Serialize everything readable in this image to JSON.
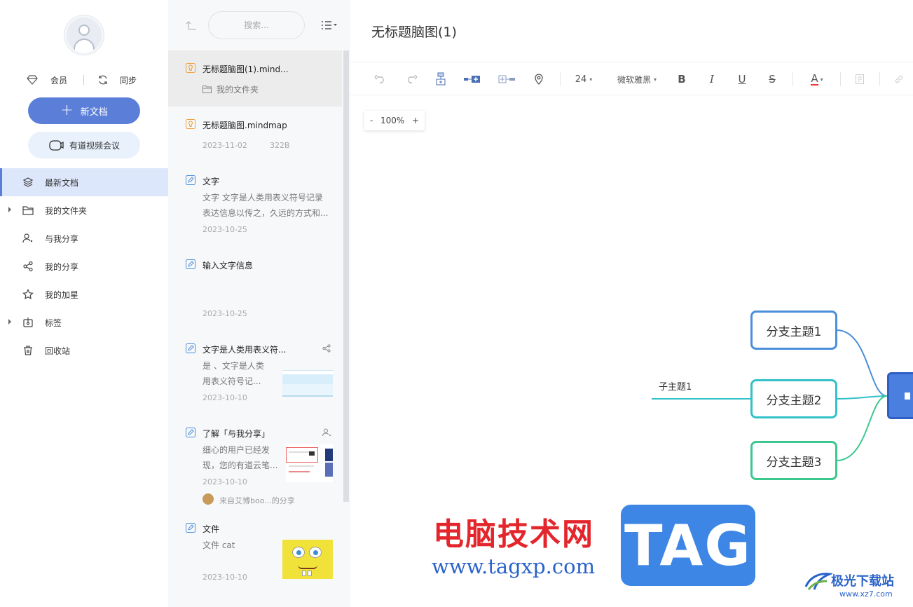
{
  "sidebar": {
    "vip_label": "会员",
    "sync_label": "同步",
    "new_doc_label": "新文档",
    "meeting_label": "有道视频会议",
    "nav": [
      {
        "label": "最新文档",
        "icon": "layers-icon",
        "active": true
      },
      {
        "label": "我的文件夹",
        "icon": "folder-icon",
        "expandable": true
      },
      {
        "label": "与我分享",
        "icon": "users-icon"
      },
      {
        "label": "我的分享",
        "icon": "share-icon"
      },
      {
        "label": "我的加星",
        "icon": "star-icon"
      },
      {
        "label": "标签",
        "icon": "tag-icon",
        "expandable": true
      },
      {
        "label": "回收站",
        "icon": "trash-icon"
      }
    ]
  },
  "doclist": {
    "search_placeholder": "搜索...",
    "docs": [
      {
        "title": "无标题脑图(1).mind...",
        "folder": "我的文件夹"
      },
      {
        "title": "无标题脑图.mindmap",
        "date": "2023-11-02",
        "size": "322B"
      },
      {
        "title": "文字",
        "line1": "文字 文字是人类用表义符号记录",
        "line2": "表达信息以传之，久远的方式和...",
        "date": "2023-10-25"
      },
      {
        "title": "输入文字信息",
        "date": "2023-10-25"
      },
      {
        "title": "文字是人类用表义符...",
        "line1": "是 、文字是人类",
        "line2": "用表义符号记...",
        "date": "2023-10-10"
      },
      {
        "title": "了解「与我分享」",
        "line1": "细心的用户已经发",
        "line2": "现，您的有道云笔...",
        "date": "2023-10-10",
        "source": "来自艾博boo...的分享"
      },
      {
        "title": "文件",
        "line1": "文件 cat",
        "date": "2023-10-10"
      }
    ]
  },
  "editor": {
    "title": "无标题脑图(1)",
    "font_size": "24",
    "font_family": "微软雅黑",
    "zoom": "100%",
    "zoom_minus": "-",
    "zoom_plus": "+"
  },
  "mindmap": {
    "branches": [
      "分支主题1",
      "分支主题2",
      "分支主题3"
    ],
    "subtopic": "子主题1",
    "colors": {
      "branch1": "#4a8fd9",
      "branch2": "#33c1c9",
      "branch3": "#3cc78e",
      "root": "#4a7fe0"
    }
  },
  "watermark": {
    "cn": "电脑技术网",
    "url": "www.tagxp.com",
    "tag": "TAG",
    "site_cn": "极光下载站",
    "site_url": "www.xz7.com"
  }
}
